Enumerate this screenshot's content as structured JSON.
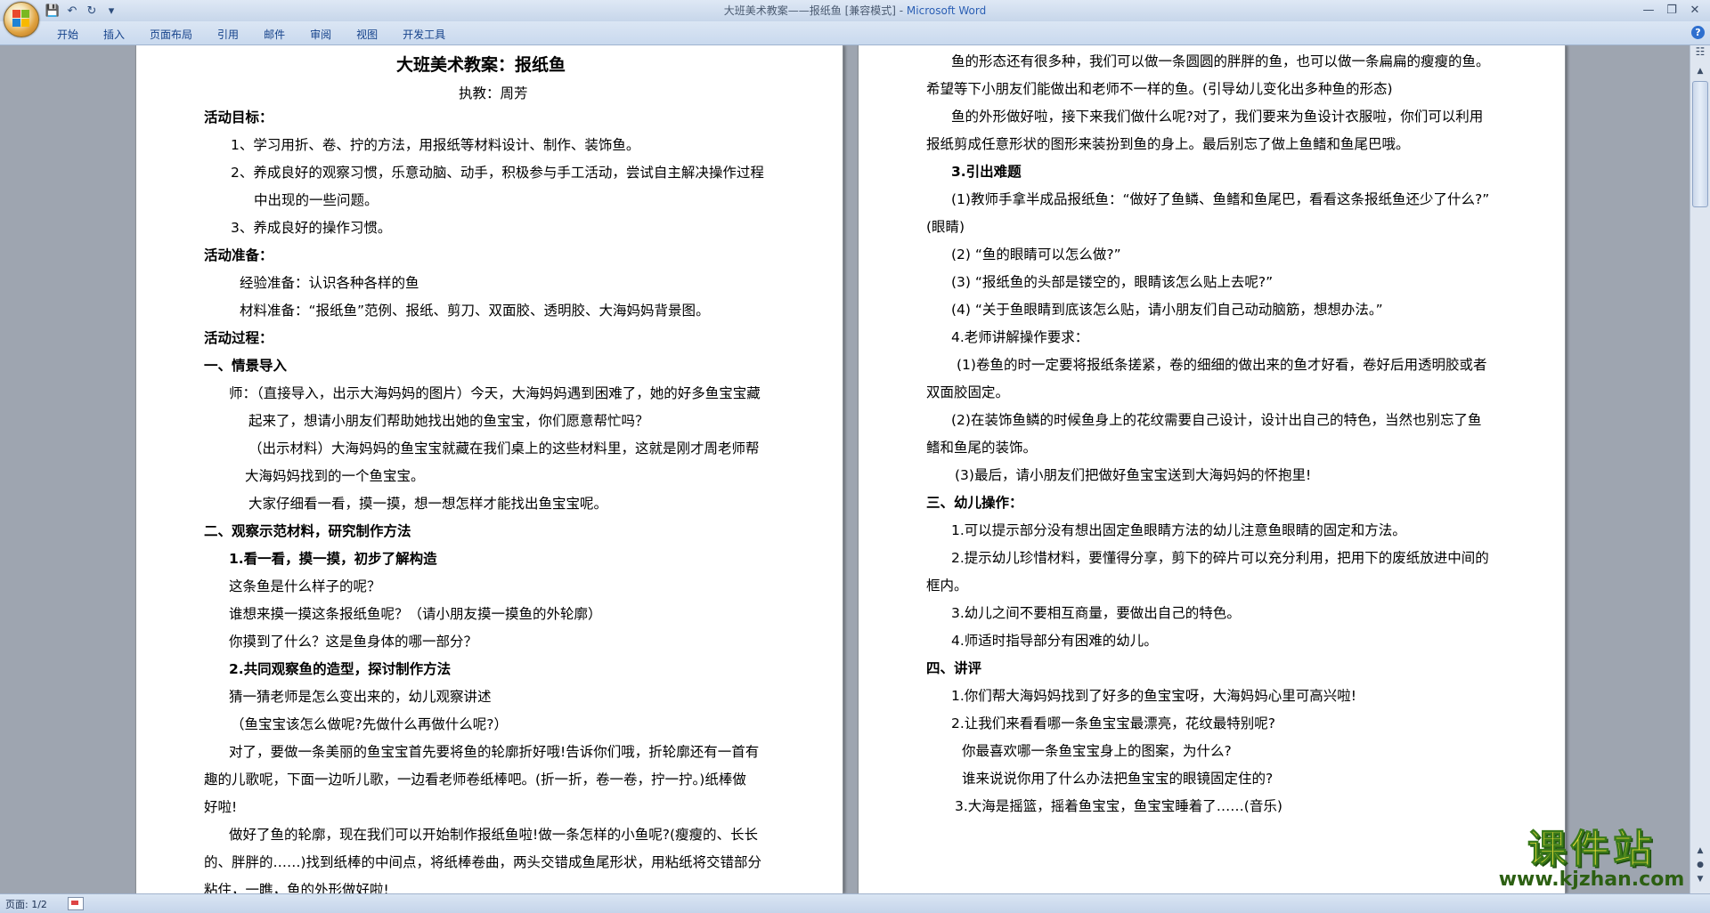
{
  "window": {
    "title": "大班美术教案——报纸鱼 [兼容模式] - ",
    "app": "Microsoft Word"
  },
  "ribbon": {
    "tabs": [
      "开始",
      "插入",
      "页面布局",
      "引用",
      "邮件",
      "审阅",
      "视图",
      "开发工具"
    ]
  },
  "page1": [
    "大班美术教案：报纸鱼",
    "执教：周芳",
    "活动目标：",
    "1、学习用折、卷、拧的方法，用报纸等材料设计、制作、装饰鱼。",
    "2、养成良好的观察习惯，乐意动脑、动手，积极参与手工活动，尝试自主解决操作过程",
    "中出现的一些问题。",
    "3、养成良好的操作习惯。",
    "活动准备：",
    "经验准备：认识各种各样的鱼",
    "材料准备：“报纸鱼”范例、报纸、剪刀、双面胶、透明胶、大海妈妈背景图。",
    "活动过程：",
    "一、情景导入",
    "师：（直接导入，出示大海妈妈的图片）今天，大海妈妈遇到困难了，她的好多鱼宝宝藏",
    "起来了，想请小朋友们帮助她找出她的鱼宝宝，你们愿意帮忙吗？",
    "（出示材料）大海妈妈的鱼宝宝就藏在我们桌上的这些材料里，这就是刚才周老师帮",
    "大海妈妈找到的一个鱼宝宝。",
    "大家仔细看一看，摸一摸，想一想怎样才能找出鱼宝宝呢。",
    "二、观察示范材料，研究制作方法",
    "1.看一看，摸一摸，初步了解构造",
    "这条鱼是什么样子的呢？",
    "谁想来摸一摸这条报纸鱼呢？（请小朋友摸一摸鱼的外轮廓）",
    "你摸到了什么？这是鱼身体的哪一部分？",
    "2.共同观察鱼的造型，探讨制作方法",
    "猜一猜老师是怎么变出来的，幼儿观察讲述",
    "（鱼宝宝该怎么做呢?先做什么再做什么呢?）",
    "对了，要做一条美丽的鱼宝宝首先要将鱼的轮廓折好哦!告诉你们哦，折轮廓还有一首有",
    "趣的儿歌呢，下面一边听儿歌，一边看老师卷纸棒吧。(折一折，卷一卷，拧一拧。)纸棒做",
    "好啦!",
    "做好了鱼的轮廓，现在我们可以开始制作报纸鱼啦!做一条怎样的小鱼呢?(瘦瘦的、长长",
    "的、胖胖的……)找到纸棒的中间点，将纸棒卷曲，两头交错成鱼尾形状，用粘纸将交错部分",
    "粘住，一瞧，鱼的外形做好啦!"
  ],
  "page2": [
    "鱼的形态还有很多种，我们可以做一条圆圆的胖胖的鱼，也可以做一条扁扁的瘦瘦的鱼。",
    "希望等下小朋友们能做出和老师不一样的鱼。(引导幼儿变化出多种鱼的形态)",
    "鱼的外形做好啦，接下来我们做什么呢?对了，我们要来为鱼设计衣服啦，你们可以利用",
    "报纸剪成任意形状的图形来装扮到鱼的身上。最后别忘了做上鱼鳍和鱼尾巴哦。",
    "3.引出难题",
    "(1)教师手拿半成品报纸鱼：“做好了鱼鳞、鱼鳍和鱼尾巴，看看这条报纸鱼还少了什么?”",
    "(眼睛)",
    "(2) “鱼的眼睛可以怎么做?”",
    "(3) “报纸鱼的头部是镂空的，眼睛该怎么贴上去呢?”",
    "(4) “关于鱼眼睛到底该怎么贴，请小朋友们自己动动脑筋，想想办法。”",
    "4.老师讲解操作要求：",
    "(1)卷鱼的时一定要将报纸条搓紧，卷的细细的做出来的鱼才好看，卷好后用透明胶或者",
    "双面胶固定。",
    "(2)在装饰鱼鳞的时候鱼身上的花纹需要自己设计，设计出自己的特色，当然也别忘了鱼",
    "鳍和鱼尾的装饰。",
    "(3)最后，请小朋友们把做好鱼宝宝送到大海妈妈的怀抱里!",
    "三、幼儿操作：",
    "1.可以提示部分没有想出固定鱼眼睛方法的幼儿注意鱼眼睛的固定和方法。",
    "2.提示幼儿珍惜材料，要懂得分享，剪下的碎片可以充分利用，把用下的废纸放进中间的",
    "框内。",
    "3.幼儿之间不要相互商量，要做出自己的特色。",
    "4.师适时指导部分有困难的幼儿。",
    "四、讲评",
    "1.你们帮大海妈妈找到了好多的鱼宝宝呀，大海妈妈心里可高兴啦!",
    "2.让我们来看看哪一条鱼宝宝最漂亮，花纹最特别呢?",
    "你最喜欢哪一条鱼宝宝身上的图案，为什么?",
    "谁来说说你用了什么办法把鱼宝宝的眼镜固定住的?",
    "3.大海是摇篮，摇着鱼宝宝，鱼宝宝睡着了……(音乐)"
  ],
  "status": {
    "page": "页面: 1/2"
  },
  "watermark": {
    "brand": "课件站",
    "url": "www.kjzhan.com"
  }
}
